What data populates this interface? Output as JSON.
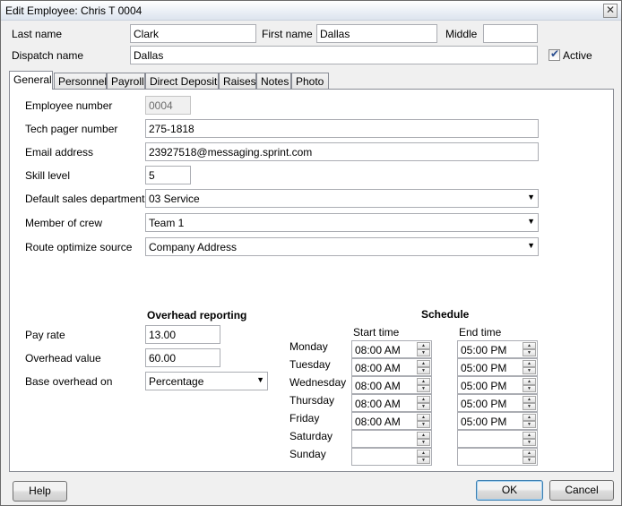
{
  "window": {
    "title": "Edit Employee: Chris T 0004",
    "close_glyph": "✕"
  },
  "header": {
    "last_name_label": "Last name",
    "last_name": "Clark",
    "first_name_label": "First name",
    "first_name": "Dallas",
    "middle_label": "Middle",
    "middle": "",
    "dispatch_label": "Dispatch name",
    "dispatch": "Dallas",
    "active_label": "Active",
    "active_checked": true
  },
  "tabs": [
    "General",
    "Personnel",
    "Payroll",
    "Direct Deposit",
    "Raises",
    "Notes",
    "Photo"
  ],
  "general": {
    "employee_number_label": "Employee number",
    "employee_number": "0004",
    "pager_label": "Tech pager number",
    "pager": "275-1818",
    "email_label": "Email address",
    "email": "23927518@messaging.sprint.com",
    "skill_label": "Skill level",
    "skill": "5",
    "dept_label": "Default sales department",
    "dept": "03 Service",
    "crew_label": "Member of crew",
    "crew": "Team 1",
    "route_label": "Route optimize source",
    "route": "Company Address"
  },
  "overhead": {
    "heading": "Overhead reporting",
    "pay_rate_label": "Pay rate",
    "pay_rate": "13.00",
    "overhead_value_label": "Overhead value",
    "overhead_value": "60.00",
    "base_label": "Base overhead on",
    "base": "Percentage"
  },
  "schedule": {
    "heading": "Schedule",
    "start_label": "Start time",
    "end_label": "End time",
    "days": [
      {
        "day": "Monday",
        "start": "08:00 AM",
        "end": "05:00 PM"
      },
      {
        "day": "Tuesday",
        "start": "08:00 AM",
        "end": "05:00 PM"
      },
      {
        "day": "Wednesday",
        "start": "08:00 AM",
        "end": "05:00 PM"
      },
      {
        "day": "Thursday",
        "start": "08:00 AM",
        "end": "05:00 PM"
      },
      {
        "day": "Friday",
        "start": "08:00 AM",
        "end": "05:00 PM"
      },
      {
        "day": "Saturday",
        "start": "",
        "end": ""
      },
      {
        "day": "Sunday",
        "start": "",
        "end": ""
      }
    ]
  },
  "footer": {
    "help": "Help",
    "ok": "OK",
    "cancel": "Cancel"
  }
}
